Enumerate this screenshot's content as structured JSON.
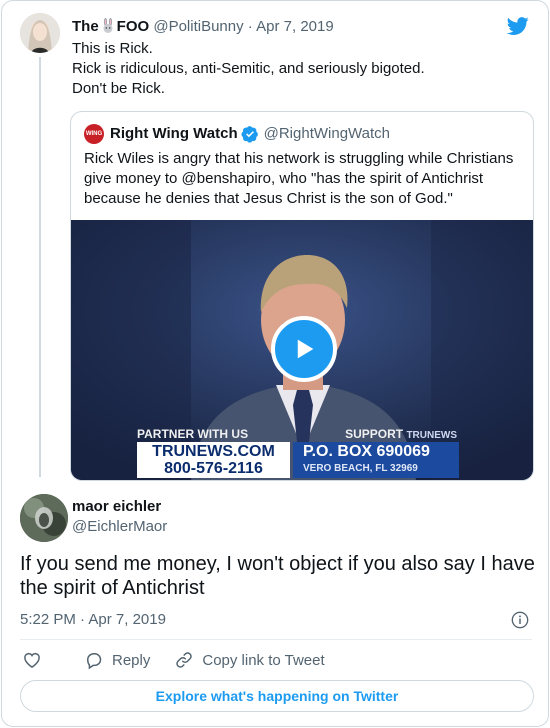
{
  "parent": {
    "name_prefix": "The",
    "name_suffix": "FOO",
    "handle": "@PolitiBunny",
    "separator": "·",
    "date": "Apr 7, 2019",
    "lines": [
      "This is Rick.",
      "Rick is ridiculous, anti-Semitic, and seriously bigoted.",
      "Don't be Rick."
    ]
  },
  "quote": {
    "name": "Right Wing Watch",
    "handle": "@RightWingWatch",
    "logo_text": "WING",
    "text": "Rick Wiles is angry that his network is struggling while Christians give money to @benshapiro, who \"has the spirit of Antichrist because he denies that Jesus Christ is the son of God.\"",
    "video": {
      "banner_partner": "PARTNER WITH US",
      "banner_support": "SUPPORT",
      "banner_brand": "TRUNEWS",
      "url": "TRUNEWS.COM",
      "phone": "800-576-2116",
      "po_box": "P.O. BOX 690069",
      "city": "VERO BEACH, FL 32969"
    }
  },
  "main": {
    "name": "maor eichler",
    "handle": "@EichlerMaor",
    "text": "If you send me money, I won't object if you also say I have the spirit of Antichrist",
    "time": "5:22 PM",
    "separator": "·",
    "date": "Apr 7, 2019"
  },
  "actions": {
    "reply": "Reply",
    "copy_link": "Copy link to Tweet"
  },
  "explore": "Explore what's happening on Twitter",
  "colors": {
    "accent": "#1d9bf0",
    "text": "#0f1419",
    "secondary": "#536471",
    "border": "#cfd9de"
  },
  "icons": [
    "twitter-bird-icon",
    "bunny-emoji-icon",
    "verified-badge-icon",
    "play-icon",
    "info-icon",
    "heart-icon",
    "reply-icon",
    "link-icon"
  ]
}
